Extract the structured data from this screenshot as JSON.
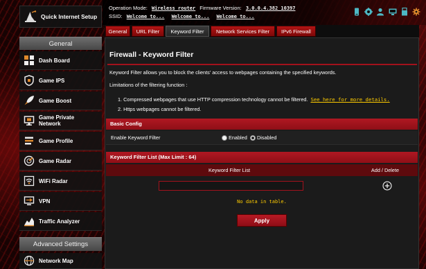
{
  "colors": {
    "accent": "#a3121c",
    "accent_dark": "#5e0a0d",
    "link": "#ffcc00",
    "status_icon": "#4db8c4",
    "gear_icon": "#e08a2c"
  },
  "header": {
    "operation_mode_label": "Operation Mode:",
    "operation_mode_value": "Wireless router",
    "firmware_label": "Firmware Version:",
    "firmware_value": "3.0.0.4.382_10397",
    "ssid_label": "SSID:",
    "ssids": [
      "Welcome to...",
      "Welcome to...",
      "Welcome to..."
    ],
    "status_icons": [
      "device-icon",
      "network-icon",
      "user-icon",
      "monitor-icon",
      "usb-icon",
      "gear-icon"
    ]
  },
  "sidebar": {
    "quick_setup": {
      "label": "Quick Internet Setup",
      "icon": "wizard-icon"
    },
    "general_header": "General",
    "items": [
      {
        "label": "Dash Board",
        "icon": "dashboard-icon"
      },
      {
        "label": "Game IPS",
        "icon": "shield-icon"
      },
      {
        "label": "Game Boost",
        "icon": "rocket-icon"
      },
      {
        "label": "Game Private Network",
        "icon": "private-network-icon"
      },
      {
        "label": "Game Profile",
        "icon": "game-profile-icon"
      },
      {
        "label": "Game Radar",
        "icon": "radar-icon"
      },
      {
        "label": "WiFi Radar",
        "icon": "wifi-radar-icon"
      },
      {
        "label": "VPN",
        "icon": "vpn-icon"
      },
      {
        "label": "Traffic Analyzer",
        "icon": "traffic-analyzer-icon"
      }
    ],
    "advanced_header": "Advanced Settings",
    "advanced_items": [
      {
        "label": "Network Map",
        "icon": "globe-icon"
      }
    ]
  },
  "tabs": [
    {
      "label": "General",
      "active": false
    },
    {
      "label": "URL Filter",
      "active": false
    },
    {
      "label": "Keyword Filter",
      "active": true
    },
    {
      "label": "Network Services Filter",
      "active": false
    },
    {
      "label": "IPv6 Firewall",
      "active": false
    }
  ],
  "content": {
    "title": "Firewall - Keyword Filter",
    "description": "Keyword Filter allows you to block the clients' access to webpages containing the specified keywords.",
    "limitations_label": "Limitations of the filtering function :",
    "limitations": [
      "1. Compressed webpages that use HTTP compression technology cannot be filtered.",
      "2. Https webpages cannot be filtered."
    ],
    "details_link": "See here for more details.",
    "basic_config": {
      "title": "Basic Config",
      "enable_label": "Enable Keyword Filter",
      "options": [
        "Enabled",
        "Disabled"
      ],
      "selected": "Disabled"
    },
    "keyword_list": {
      "title": "Keyword Filter List (Max Limit : 64)",
      "columns": [
        "Keyword Filter List",
        "Add / Delete"
      ],
      "input_value": "",
      "empty_message": "No data in table."
    },
    "apply_label": "Apply"
  }
}
